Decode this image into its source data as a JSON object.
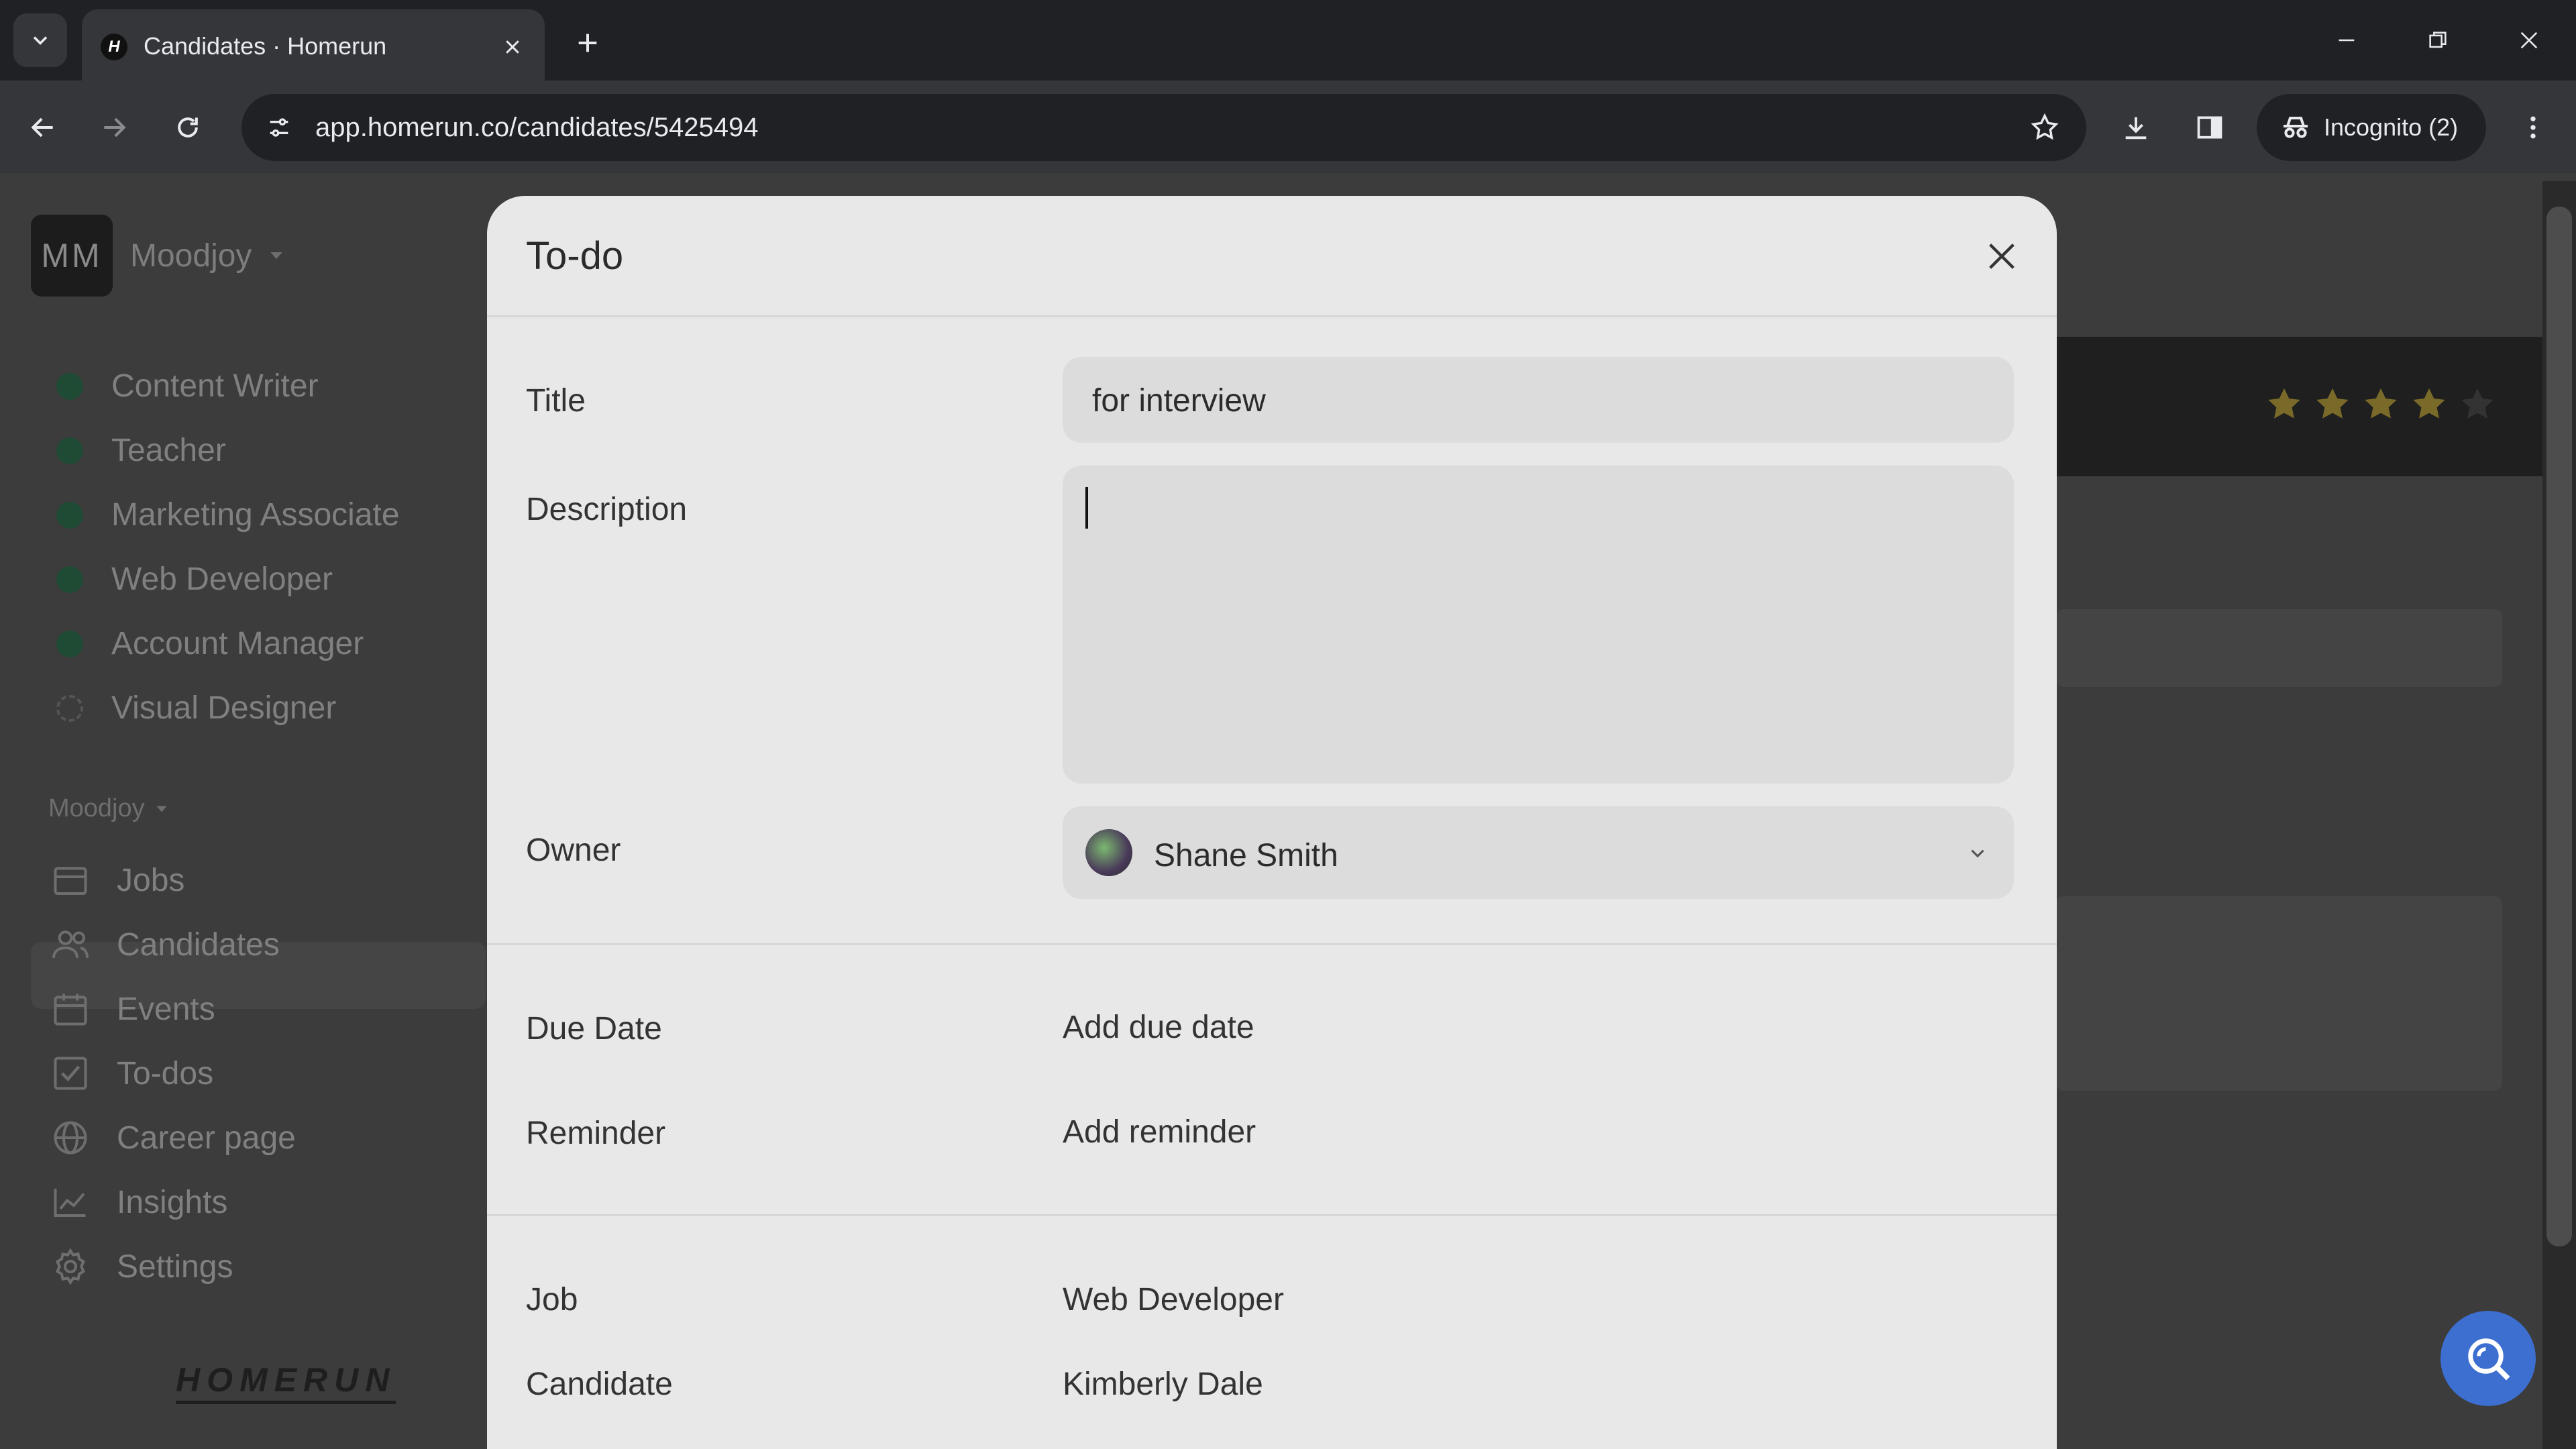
{
  "browser": {
    "tab_title": "Candidates · Homerun",
    "favicon_letter": "H",
    "url": "app.homerun.co/candidates/5425494",
    "incognito_label": "Incognito (2)"
  },
  "sidebar": {
    "org_initials": "MM",
    "org_name": "Moodjoy",
    "jobs": [
      {
        "label": "Content Writer",
        "status": "published"
      },
      {
        "label": "Teacher",
        "status": "published"
      },
      {
        "label": "Marketing Associate",
        "status": "published"
      },
      {
        "label": "Web Developer",
        "status": "published"
      },
      {
        "label": "Account Manager",
        "status": "published"
      },
      {
        "label": "Visual Designer",
        "status": "draft"
      }
    ],
    "section_label": "Moodjoy",
    "nav": [
      {
        "label": "Jobs",
        "icon": "briefcase-icon"
      },
      {
        "label": "Candidates",
        "icon": "users-icon",
        "active": true
      },
      {
        "label": "Events",
        "icon": "calendar-icon"
      },
      {
        "label": "To-dos",
        "icon": "checkbox-icon"
      },
      {
        "label": "Career page",
        "icon": "globe-icon"
      },
      {
        "label": "Insights",
        "icon": "chart-line-icon"
      },
      {
        "label": "Settings",
        "icon": "gear-icon"
      }
    ],
    "logo_text": "HOMERUN"
  },
  "background": {
    "rating_stars": 4,
    "rating_max": 5
  },
  "modal": {
    "title": "To-do",
    "fields": {
      "title_label": "Title",
      "title_value": "for interview",
      "description_label": "Description",
      "description_value": "",
      "owner_label": "Owner",
      "owner_value": "Shane Smith",
      "due_date_label": "Due Date",
      "due_date_action": "Add due date",
      "reminder_label": "Reminder",
      "reminder_action": "Add reminder",
      "job_label": "Job",
      "job_value": "Web Developer",
      "candidate_label": "Candidate",
      "candidate_value": "Kimberly Dale"
    }
  },
  "colors": {
    "accent_fab": "#3d6fd0",
    "published_dot": "#1f4a33",
    "star": "#7a6a2a"
  }
}
